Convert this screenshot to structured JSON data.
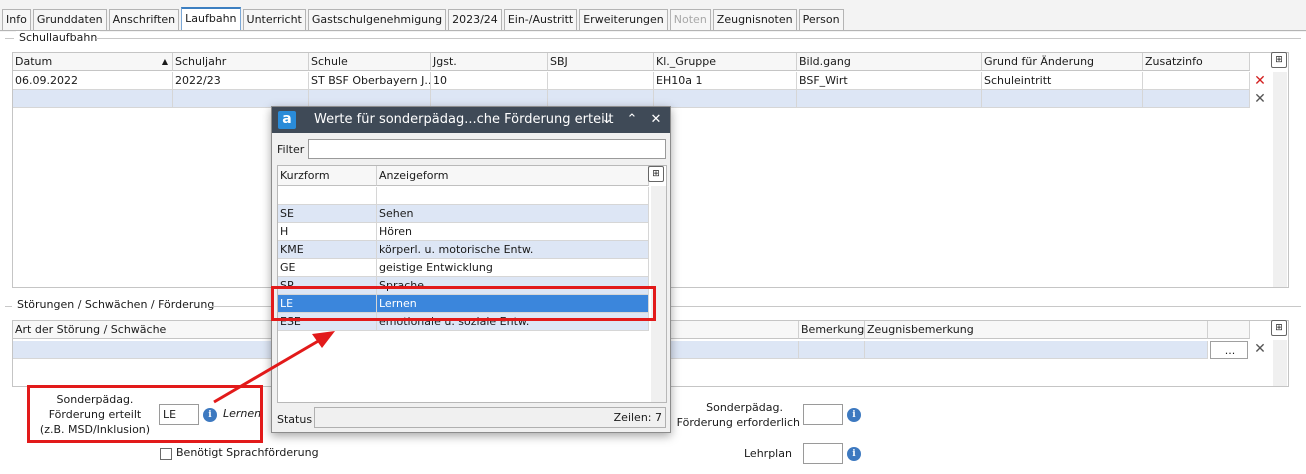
{
  "tabs": [
    "Info",
    "Grunddaten",
    "Anschriften",
    "Laufbahn",
    "Unterricht",
    "Gastschulgenehmigung",
    "2023/24",
    "Ein-/Austritt",
    "Erweiterungen",
    "Noten",
    "Zeugnisnoten",
    "Person"
  ],
  "active_tab": "Laufbahn",
  "disabled_tab": "Noten",
  "schullaufbahn": {
    "group_label": "Schullaufbahn",
    "columns": [
      "Datum",
      "Schuljahr",
      "Schule",
      "Jgst.",
      "SBJ",
      "Kl._Gruppe",
      "Bild.gang",
      "Grund für Änderung",
      "Zusatzinfo"
    ],
    "rows": [
      [
        "06.09.2022",
        "2022/23",
        "ST BSF Oberbayern J...",
        "10",
        "",
        "EH10a 1",
        "BSF_Wirt",
        "Schuleintritt",
        ""
      ]
    ]
  },
  "stoerungen": {
    "group_label": "Störungen / Schwächen / Förderung",
    "col_art": "Art der Störung / Schwäche",
    "col_bemerkung": "Bemerkung",
    "col_zeugnisbemerkung": "Zeugnisbemerkung",
    "ellipsis": "..."
  },
  "form": {
    "sonderpaed_label_1": "Sonderpädag.",
    "sonderpaed_label_2": "Förderung erteilt",
    "sonderpaed_label_3": "(z.B. MSD/Inklusion)",
    "sonderpaed_value": "LE",
    "sonderpaed_desc": "Lernen",
    "checkbox_label": "Benötigt Sprachförderung",
    "erforderlich_label_1": "Sonderpädag.",
    "erforderlich_label_2": "Förderung erforderlich",
    "lehrplan_label": "Lehrplan"
  },
  "dialog": {
    "title": "Werte für sonderpädag...che Förderung erteilt",
    "filter_label": "Filter",
    "filter_value": "",
    "columns": [
      "Kurzform",
      "Anzeigeform"
    ],
    "rows": [
      [
        "",
        ""
      ],
      [
        "SE",
        "Sehen"
      ],
      [
        "H",
        "Hören"
      ],
      [
        "KME",
        "körperl. u. motorische Entw."
      ],
      [
        "GE",
        "geistige Entwicklung"
      ],
      [
        "SP",
        "Sprache"
      ],
      [
        "LE",
        "Lernen"
      ],
      [
        "ESE",
        "emotionale u. soziale Entw."
      ]
    ],
    "selected_row": 6,
    "status_label": "Status",
    "rows_count": "Zeilen: 7"
  },
  "colors": {
    "highlight": "#e21a1a",
    "selection": "#3b86dc",
    "title_bar": "#3f4a57"
  }
}
